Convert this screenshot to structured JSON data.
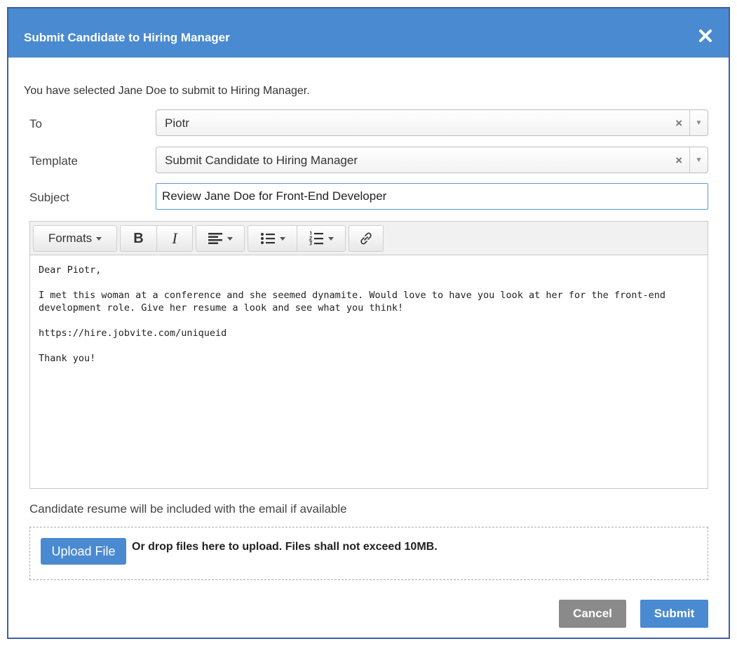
{
  "dialog": {
    "title": "Submit Candidate to Hiring Manager",
    "intro": "You have selected  Jane Doe to submit to Hiring Manager."
  },
  "form": {
    "to": {
      "label": "To",
      "value": "Piotr",
      "clear": "×"
    },
    "template": {
      "label": "Template",
      "value": "Submit Candidate to Hiring Manager",
      "clear": "×"
    },
    "subject": {
      "label": "Subject",
      "value": "Review Jane Doe for Front-End Developer"
    }
  },
  "toolbar": {
    "formats": "Formats",
    "bold": "B",
    "italic": "I"
  },
  "email_body": {
    "greeting": "Dear Piotr,",
    "paragraph": "I met this woman at a conference and she seemed dynamite. Would love to have you look at her for the front-end development role. Give her resume a look and see what you think!",
    "link": "https://hire.jobvite.com/uniqueid",
    "closing": "Thank you!"
  },
  "attachments": {
    "note": "Candidate resume will be included with the email if available",
    "upload_label": "Upload File",
    "drop_text": "Or drop files here to upload. Files shall not exceed 10MB."
  },
  "actions": {
    "cancel": "Cancel",
    "submit": "Submit"
  },
  "colors": {
    "header": "#4a8ad0",
    "cancel": "#8a8a8a",
    "primary": "#4a8ad0"
  }
}
